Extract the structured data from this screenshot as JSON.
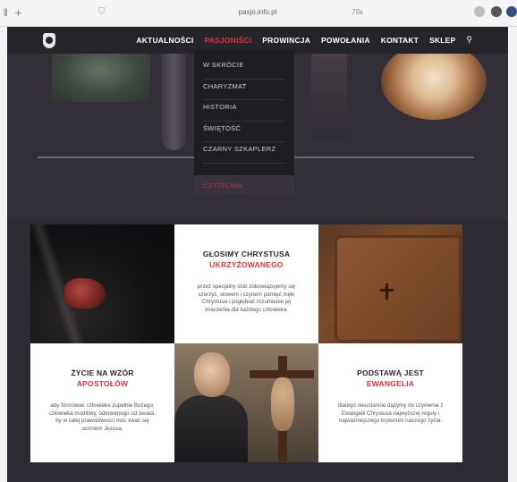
{
  "browser": {
    "url": "pasjo.info.pl",
    "zoom": "79x",
    "back_icon": "back-arrow-icon",
    "new_tab_icon": "plus-icon"
  },
  "nav": {
    "items": [
      {
        "label": "AKTUALNOŚCI",
        "active": false
      },
      {
        "label": "PASJONIŚCI",
        "active": true
      },
      {
        "label": "PROWINCJA",
        "active": false
      },
      {
        "label": "POWOŁANIA",
        "active": false
      },
      {
        "label": "KONTAKT",
        "active": false
      },
      {
        "label": "SKLEP",
        "active": false
      }
    ],
    "search_icon": "search-icon",
    "active_color": "#e0303a"
  },
  "dropdown": {
    "items": [
      {
        "label": "W SKRÓCIE",
        "selected": false
      },
      {
        "label": "CHARYZMAT",
        "selected": false
      },
      {
        "label": "HISTORIA",
        "selected": false
      },
      {
        "label": "ŚWIĘTOŚĆ",
        "selected": false
      },
      {
        "label": "CZARNY SZKAPLERZ",
        "selected": false
      },
      {
        "label": "CZYTELNIA",
        "selected": true
      }
    ]
  },
  "cards": {
    "glosimy": {
      "title": "GŁOSIMY CHRYSTUSA",
      "highlight": "UKRZYŻOWANEGO",
      "text": "przez specjalny ślub zobowiązujemy się szerzyć, słowem i czynem pamięć męki Chrystusa i pogłębiać rozumienie jej znaczenia dla każdego człowieka."
    },
    "zycie": {
      "title": "ŻYCIE NA WZÓR",
      "highlight": "APOSTOŁÓW",
      "text": "aby formować człowieka zupełnie Bożego, człowieka modlitwy, oderwanego od świata, by w całej prawdziwości móc zwać się uczniem Jezusa."
    },
    "podstawa": {
      "title": "PODSTAWĄ JEST",
      "highlight": "EWANGELIA",
      "text": "dlatego nieustannie dążymy do czynienia z Ewangelii Chrystusa najwyższej reguły i najważniejszego kryterium naszego życia."
    },
    "accent_color": "#d8323b"
  }
}
